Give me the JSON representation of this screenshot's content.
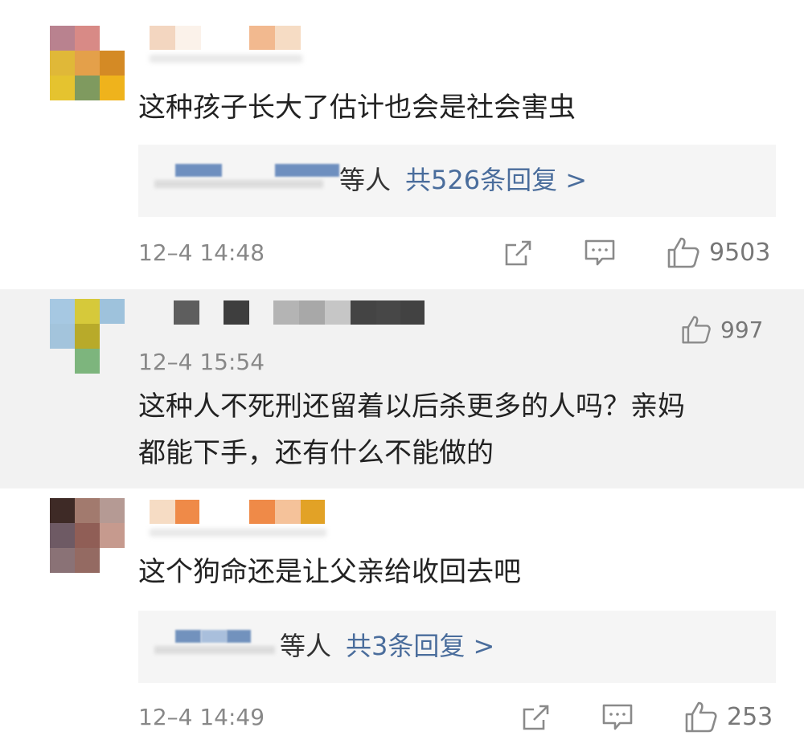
{
  "comments": [
    {
      "text": "这种孩子长大了估计也会是社会害虫",
      "reply_who": "等人",
      "reply_count": "共526条回复 >",
      "time": "12–4 14:48",
      "likes": "9503"
    },
    {
      "text_line1": "这种人不死刑还留着以后杀更多的人吗？亲妈",
      "text_line2": "都能下手，还有什么不能做的",
      "time": "12–4 15:54",
      "likes": "997"
    },
    {
      "text": "这个狗命还是让父亲给收回去吧",
      "reply_who": "等人",
      "reply_count": "共3条回复 >",
      "time": "12–4 14:49",
      "likes": "253"
    }
  ],
  "icons": {
    "share": "share-icon",
    "comment": "comment-icon",
    "like": "thumbs-up-icon"
  },
  "colors": {
    "link": "#4a6d9c",
    "muted": "#888888",
    "highlight_bg": "#f2f2f2",
    "reply_bg": "#f5f5f5"
  }
}
